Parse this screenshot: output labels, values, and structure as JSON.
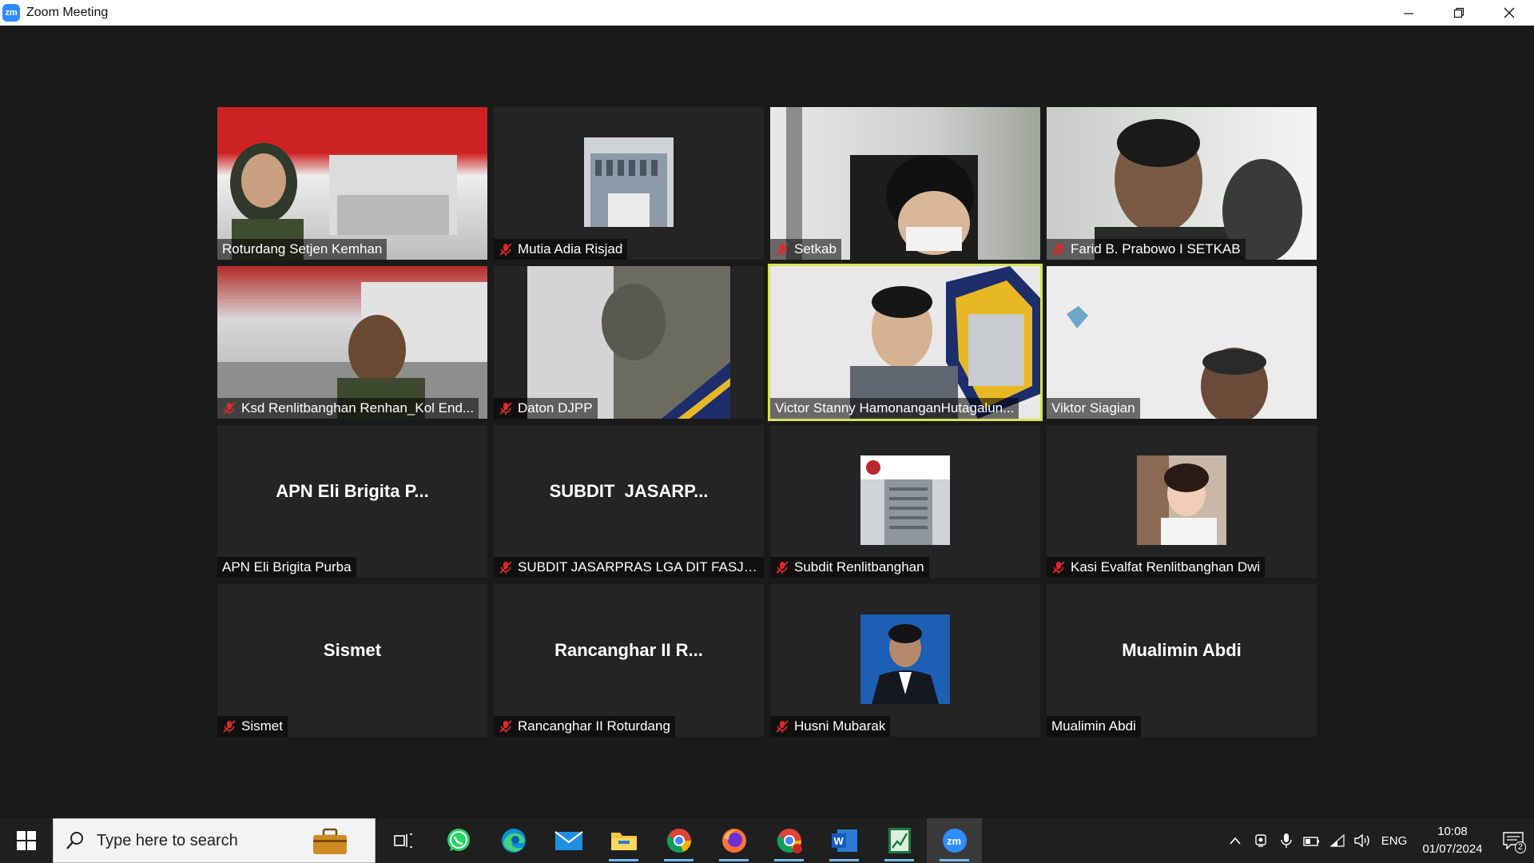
{
  "window": {
    "title": "Zoom Meeting",
    "logo_text": "zm"
  },
  "participants": [
    {
      "name": "Roturdang Setjen Kemhan",
      "muted": false,
      "video": true
    },
    {
      "name": "Mutia Adia Risjad",
      "muted": true,
      "video": false
    },
    {
      "name": "Setkab",
      "muted": true,
      "video": true
    },
    {
      "name": "Farid B. Prabowo I SETKAB",
      "muted": true,
      "video": true
    },
    {
      "name": "Ksd Renlitbanghan Renhan_Kol End...",
      "muted": true,
      "video": true
    },
    {
      "name": "Daton DJPP",
      "muted": true,
      "video": true
    },
    {
      "name": "Victor Stanny HamonanganHutagalun...",
      "muted": false,
      "video": true,
      "active_speaker": true
    },
    {
      "name": "Viktor Siagian",
      "muted": false,
      "video": true
    },
    {
      "name": "APN Eli Brigita Purba",
      "display": "APN Eli Brigita P...",
      "muted": false,
      "video": false
    },
    {
      "name": "SUBDIT JASARPRAS LGA DIT FASJAS...",
      "display": "SUBDIT  JASARP...",
      "muted": true,
      "video": false
    },
    {
      "name": "Subdit Renlitbanghan",
      "muted": true,
      "video": false
    },
    {
      "name": "Kasi Evalfat Renlitbanghan Dwi",
      "muted": true,
      "video": false
    },
    {
      "name": "Sismet",
      "display": "Sismet",
      "muted": true,
      "video": false
    },
    {
      "name": "Rancanghar II Roturdang",
      "display": "Rancanghar II R...",
      "muted": true,
      "video": false
    },
    {
      "name": "Husni Mubarak",
      "muted": true,
      "video": false
    },
    {
      "name": "Mualimin Abdi",
      "display": "Mualimin Abdi",
      "muted": false,
      "video": false
    }
  ],
  "taskbar": {
    "search_placeholder": "Type here to search",
    "apps": [
      "task-view",
      "whatsapp",
      "edge",
      "mail",
      "file-explorer",
      "chrome",
      "firefox",
      "chrome-profile",
      "word",
      "sheets",
      "zoom"
    ],
    "language": "ENG",
    "time": "10:08",
    "date": "01/07/2024",
    "notification_count": "2"
  },
  "colors": {
    "accent": "#2d8cff",
    "active_speaker_border": "#d7e35a",
    "mute_red": "#e02828",
    "background": "#1a1a1a"
  }
}
